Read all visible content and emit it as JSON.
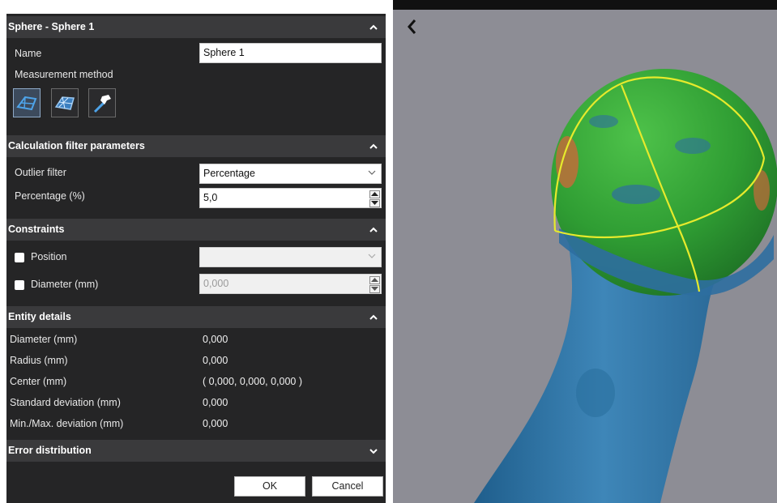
{
  "panel": {
    "title": "Sphere - Sphere 1",
    "name_label": "Name",
    "name_value": "Sphere 1",
    "measurement_method_label": "Measurement method",
    "method_buttons": [
      "surface-fit-icon",
      "mesh-fit-icon",
      "probe-tool-icon"
    ],
    "filter_section": {
      "title": "Calculation filter parameters",
      "outlier_label": "Outlier filter",
      "outlier_value": "Percentage",
      "percentage_label": "Percentage (%)",
      "percentage_value": "5,0"
    },
    "constraints": {
      "title": "Constraints",
      "position_label": "Position",
      "position_value": "",
      "diameter_label": "Diameter (mm)",
      "diameter_value": "0,000"
    },
    "entity_details": {
      "title": "Entity details",
      "rows": [
        {
          "label": "Diameter (mm)",
          "value": "0,000"
        },
        {
          "label": "Radius (mm)",
          "value": "0,000"
        },
        {
          "label": "Center (mm)",
          "value": "( 0,000, 0,000, 0,000 )"
        },
        {
          "label": "Standard deviation (mm)",
          "value": "0,000"
        },
        {
          "label": "Min./Max. deviation (mm)",
          "value": "0,000"
        }
      ]
    },
    "error_distribution": {
      "title": "Error distribution"
    },
    "ok_label": "OK",
    "cancel_label": "Cancel"
  },
  "viewport": {
    "back_icon": "chevron-left-icon",
    "background_color": "#8d8d95",
    "model_colors": {
      "mesh": "#2f6e9c",
      "fit_in_tolerance": "#2fa236",
      "deviation_high": "#c86a3a",
      "fit_outline": "#e6ea2c"
    }
  }
}
